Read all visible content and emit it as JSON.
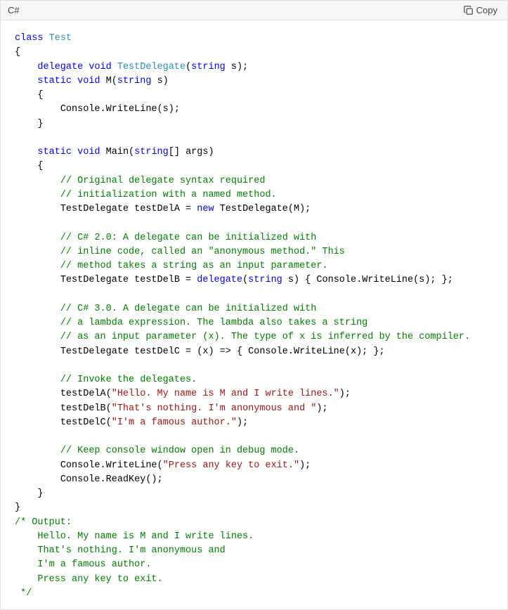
{
  "header": {
    "language": "C#",
    "copy_label": "Copy"
  },
  "code": {
    "k_class": "class",
    "cls_test": "Test",
    "lbrace": "{",
    "rbrace": "}",
    "indent1": "    ",
    "indent2": "        ",
    "k_delegate": "delegate",
    "k_void": "void",
    "type_testdelegate": "TestDelegate",
    "k_string": "string",
    "sig_s": "(",
    "param_s": " s);",
    "k_static": "static",
    "method_M": "M",
    "param_s2": " s)",
    "console_wl_s": "Console.WriteLine(s);",
    "method_Main": "Main",
    "param_args": "[] args)",
    "com_orig1": "// Original delegate syntax required",
    "com_orig2": "// initialization with a named method.",
    "testdelA_decl": "TestDelegate testDelA = ",
    "k_new": "new",
    "testdelegate_m": " TestDelegate(M);",
    "com_20_1": "// C# 2.0: A delegate can be initialized with",
    "com_20_2": "// inline code, called an \"anonymous method.\" This",
    "com_20_3": "// method takes a string as an input parameter.",
    "testdelB_decl": "TestDelegate testDelB = ",
    "paren": "(",
    "anon_body": " s) { Console.WriteLine(s); };",
    "com_30_1": "// C# 3.0. A delegate can be initialized with",
    "com_30_2": "// a lambda expression. The lambda also takes a string",
    "com_30_3": "// as an input parameter (x). The type of x is inferred by the compiler.",
    "testdelC": "TestDelegate testDelC = (x) => { Console.WriteLine(x); };",
    "com_invoke": "// Invoke the delegates.",
    "invA_pre": "testDelA(",
    "invA_str": "\"Hello. My name is M and I write lines.\"",
    "close_paren": ");",
    "invB_pre": "testDelB(",
    "invB_str": "\"That's nothing. I'm anonymous and \"",
    "invC_pre": "testDelC(",
    "invC_str": "\"I'm a famous author.\"",
    "com_keep": "// Keep console window open in debug mode.",
    "cw_pre": "Console.WriteLine(",
    "cw_str": "\"Press any key to exit.\"",
    "readkey": "Console.ReadKey();",
    "out1": "/* Output:",
    "out2": "    Hello. My name is M and I write lines.",
    "out3": "    That's nothing. I'm anonymous and",
    "out4": "    I'm a famous author.",
    "out5": "    Press any key to exit.",
    "out6": " */"
  }
}
